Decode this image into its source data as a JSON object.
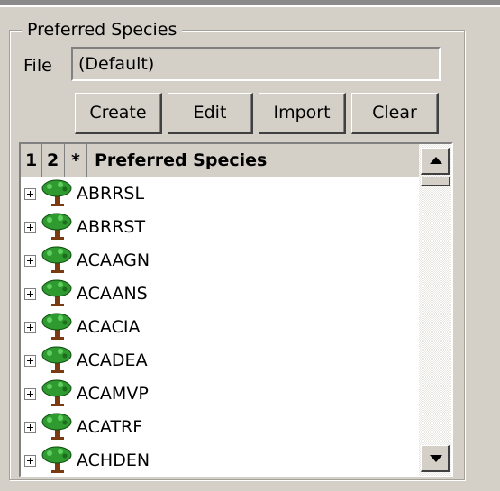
{
  "group": {
    "title": "Preferred Species"
  },
  "file": {
    "label": "File",
    "value": "(Default)"
  },
  "buttons": {
    "create": "Create",
    "edit": "Edit",
    "import": "Import",
    "clear": "Clear"
  },
  "list": {
    "headers": [
      "1",
      "2",
      "*",
      "Preferred Species"
    ],
    "items": [
      {
        "label": "ABRRSL",
        "icon": "tree-icon"
      },
      {
        "label": "ABRRST",
        "icon": "tree-icon"
      },
      {
        "label": "ACAAGN",
        "icon": "tree-icon"
      },
      {
        "label": "ACAANS",
        "icon": "tree-icon"
      },
      {
        "label": "ACACIA",
        "icon": "tree-icon"
      },
      {
        "label": "ACADEA",
        "icon": "tree-icon"
      },
      {
        "label": "ACAMVP",
        "icon": "tree-icon"
      },
      {
        "label": "ACATRF",
        "icon": "tree-icon"
      },
      {
        "label": "ACHDEN",
        "icon": "tree-icon"
      }
    ]
  },
  "colors": {
    "window_bg": "#d4d0c8",
    "list_bg": "#ffffff",
    "tree_green": "#2f9a2f",
    "trunk_brown": "#7a3a12"
  }
}
